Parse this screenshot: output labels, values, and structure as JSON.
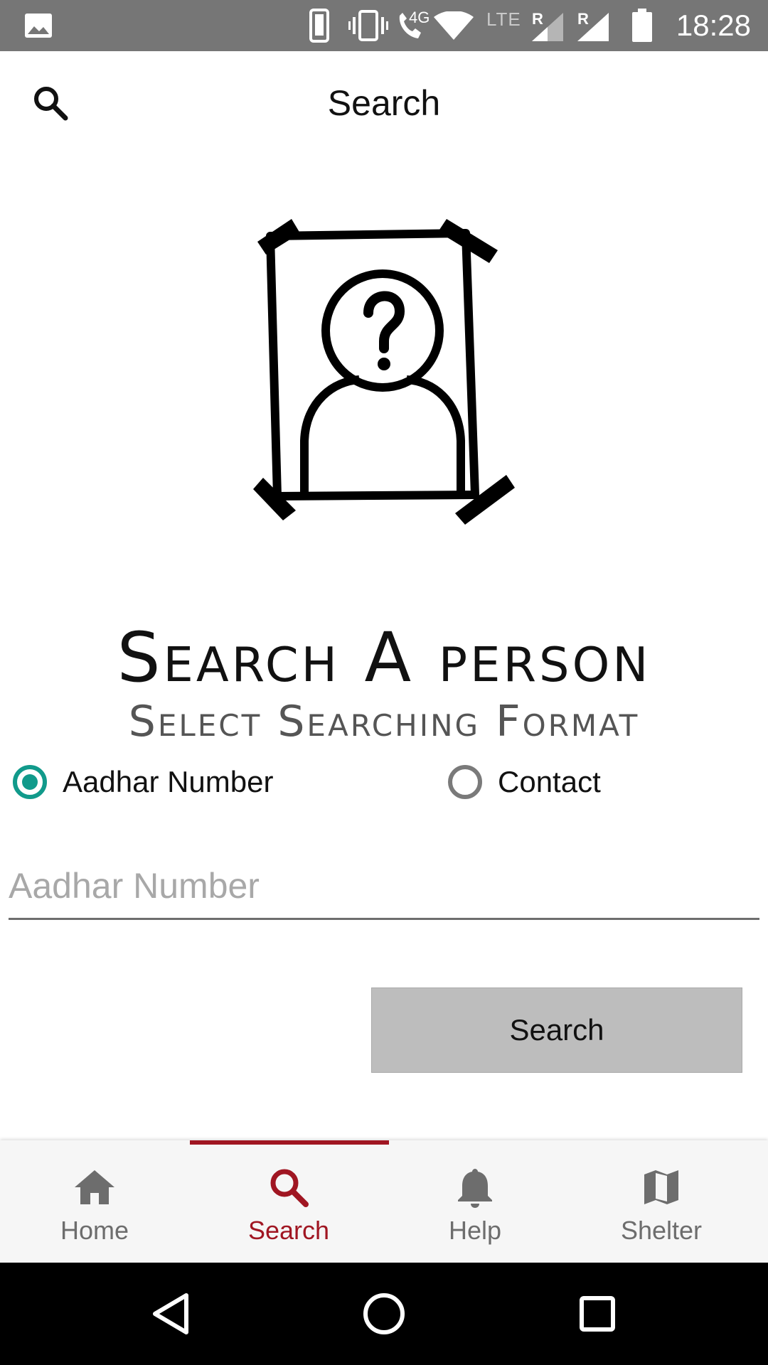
{
  "status_bar": {
    "time": "18:28",
    "network_4g": "4G",
    "network_lte": "LTE",
    "roaming_1": "R",
    "roaming_2": "R",
    "icons": [
      "image-icon",
      "phone-outline-icon",
      "vibrate-icon",
      "wifi-call-icon",
      "wifi-icon",
      "signal-icon",
      "battery-icon"
    ]
  },
  "app_bar": {
    "title": "Search",
    "icon": "search-icon"
  },
  "illustration": {
    "icon": "unknown-person-photo-icon"
  },
  "heading": "Search A person",
  "subheading": "Select Searching Format",
  "radio_group": {
    "options": [
      {
        "label": "Aadhar Number",
        "selected": true
      },
      {
        "label": "Contact",
        "selected": false
      }
    ]
  },
  "input": {
    "placeholder": "Aadhar Number",
    "value": ""
  },
  "search_button": {
    "label": "Search"
  },
  "bottom_nav": {
    "items": [
      {
        "label": "Home",
        "icon": "home-icon",
        "active": false
      },
      {
        "label": "Search",
        "icon": "search-icon",
        "active": true
      },
      {
        "label": "Help",
        "icon": "bell-icon",
        "active": false
      },
      {
        "label": "Shelter",
        "icon": "map-icon",
        "active": false
      }
    ]
  },
  "system_nav": {
    "icons": [
      "back-icon",
      "home-circle-icon",
      "recents-icon"
    ]
  },
  "colors": {
    "status_bar": "#767676",
    "accent_teal": "#119a8b",
    "accent_red": "#a01622",
    "button_gray": "#bdbdbd",
    "nav_background": "#f6f6f6"
  }
}
